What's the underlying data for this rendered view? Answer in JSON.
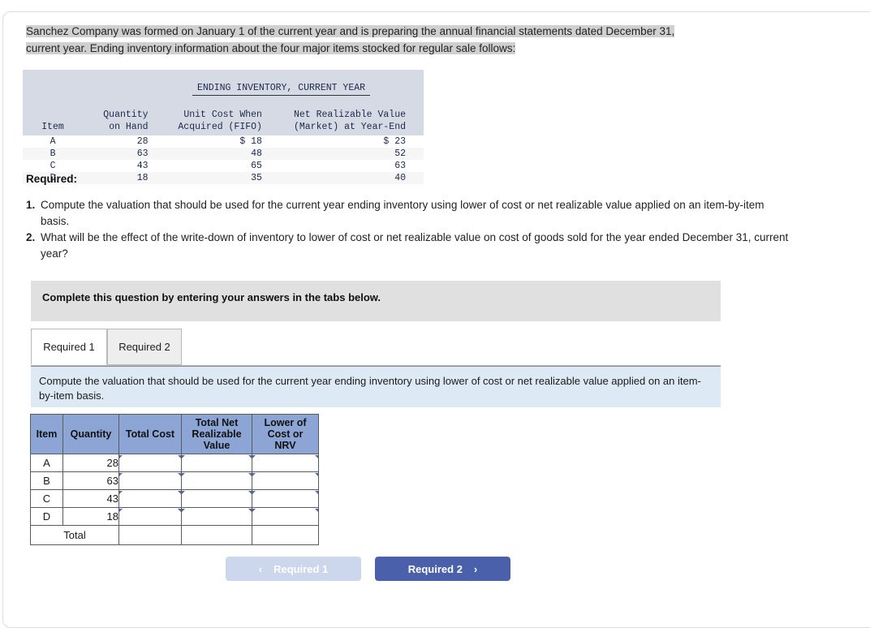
{
  "intro": {
    "line1": "Sanchez Company was formed on January 1 of the current year and is preparing the annual financial statements dated December 31,",
    "line2": "current year. Ending inventory information about the four major items stocked for regular sale follows:"
  },
  "inventory_table": {
    "title": "ENDING INVENTORY, CURRENT YEAR",
    "headers": {
      "item": "Item",
      "quantity_line1": "Quantity",
      "quantity_line2": "on Hand",
      "unit_cost_line1": "Unit Cost When",
      "unit_cost_line2": "Acquired (FIFO)",
      "nrv_line1": "Net Realizable Value",
      "nrv_line2": "(Market) at Year-End"
    },
    "rows": [
      {
        "item": "A",
        "quantity": "28",
        "unit_cost": "$ 18",
        "nrv": "$ 23"
      },
      {
        "item": "B",
        "quantity": "63",
        "unit_cost": "48",
        "nrv": "52"
      },
      {
        "item": "C",
        "quantity": "43",
        "unit_cost": "65",
        "nrv": "63"
      },
      {
        "item": "D",
        "quantity": "18",
        "unit_cost": "35",
        "nrv": "40"
      }
    ]
  },
  "required": {
    "heading": "Required:",
    "items": [
      {
        "num": "1.",
        "text": "Compute the valuation that should be used for the current year ending inventory using lower of cost or net realizable value applied on an item-by-item basis."
      },
      {
        "num": "2.",
        "text": "What will be the effect of the write-down of inventory to lower of cost or net realizable value on cost of goods sold for the year ended December 31, current year?"
      }
    ]
  },
  "banner": {
    "text": "Complete this question by entering your answers in the tabs below."
  },
  "tabs": [
    {
      "label": "Required 1",
      "active": true
    },
    {
      "label": "Required 2",
      "active": false
    }
  ],
  "instruction": {
    "text": "Compute the valuation that should be used for the current year ending inventory using lower of cost or net realizable value applied on an item-by-item basis."
  },
  "answer_table": {
    "headers": {
      "item": "Item",
      "quantity": "Quantity",
      "total_cost": "Total Cost",
      "total_nrv_line1": "Total Net",
      "total_nrv_line2": "Realizable",
      "total_nrv_line3": "Value",
      "lcnrv_line1": "Lower of",
      "lcnrv_line2": "Cost or",
      "lcnrv_line3": "NRV"
    },
    "rows": [
      {
        "item": "A",
        "quantity": "28",
        "total_cost": "",
        "total_nrv": "",
        "lcnrv": ""
      },
      {
        "item": "B",
        "quantity": "63",
        "total_cost": "",
        "total_nrv": "",
        "lcnrv": ""
      },
      {
        "item": "C",
        "quantity": "43",
        "total_cost": "",
        "total_nrv": "",
        "lcnrv": ""
      },
      {
        "item": "D",
        "quantity": "18",
        "total_cost": "",
        "total_nrv": "",
        "lcnrv": ""
      }
    ],
    "total_row": {
      "label": "Total",
      "total_cost": "",
      "total_nrv": "",
      "lcnrv": ""
    }
  },
  "nav": {
    "prev_label": "Required 1",
    "prev_chevron": "‹",
    "next_label": "Required 2",
    "next_chevron": "›"
  },
  "colors": {
    "tab_active_bg": "#ffffff",
    "tab_inactive_bg": "#eeeeee",
    "banner_bg": "#e0e0e0",
    "instruction_bg": "#ddeaf6",
    "table_header_bg": "#8da5d4",
    "input_border": "#5068ad",
    "btn_next_bg": "#4a60ab",
    "btn_prev_bg": "#ccd6ec",
    "mono_header_bg": "#d6dae5"
  }
}
